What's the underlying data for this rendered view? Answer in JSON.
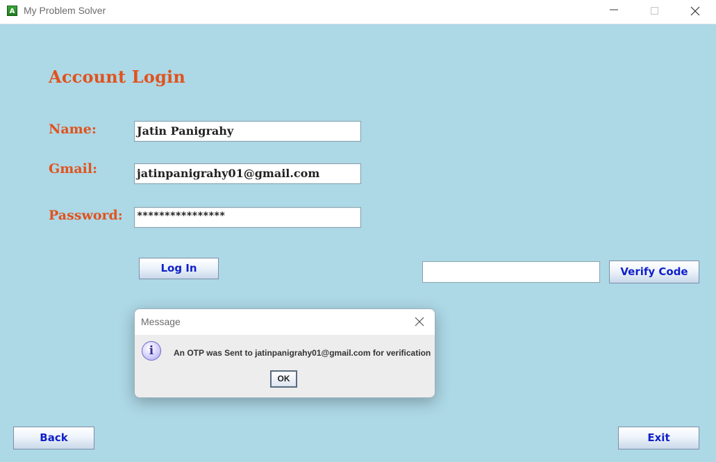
{
  "window": {
    "title": "My Problem Solver",
    "icon_letter": "A",
    "icon": "app-icon"
  },
  "form": {
    "heading": "Account Login",
    "name_label": "Name:",
    "name_value": "Jatin Panigrahy",
    "gmail_label": "Gmail:",
    "gmail_value": "jatinpanigrahy01@gmail.com",
    "password_label": "Password:",
    "password_value": "****************",
    "login_button": "Log In",
    "verification_code_value": "",
    "verify_button": "Verify Code"
  },
  "footer": {
    "back_button": "Back",
    "exit_button": "Exit"
  },
  "dialog": {
    "title": "Message",
    "icon": "info-icon",
    "icon_glyph": "i",
    "message": "An OTP was Sent to jatinpanigrahy01@gmail.com for verification",
    "ok_button": "OK"
  },
  "colors": {
    "background": "#add8e6",
    "label_accent": "#e0531d",
    "button_text": "#1020c8"
  }
}
